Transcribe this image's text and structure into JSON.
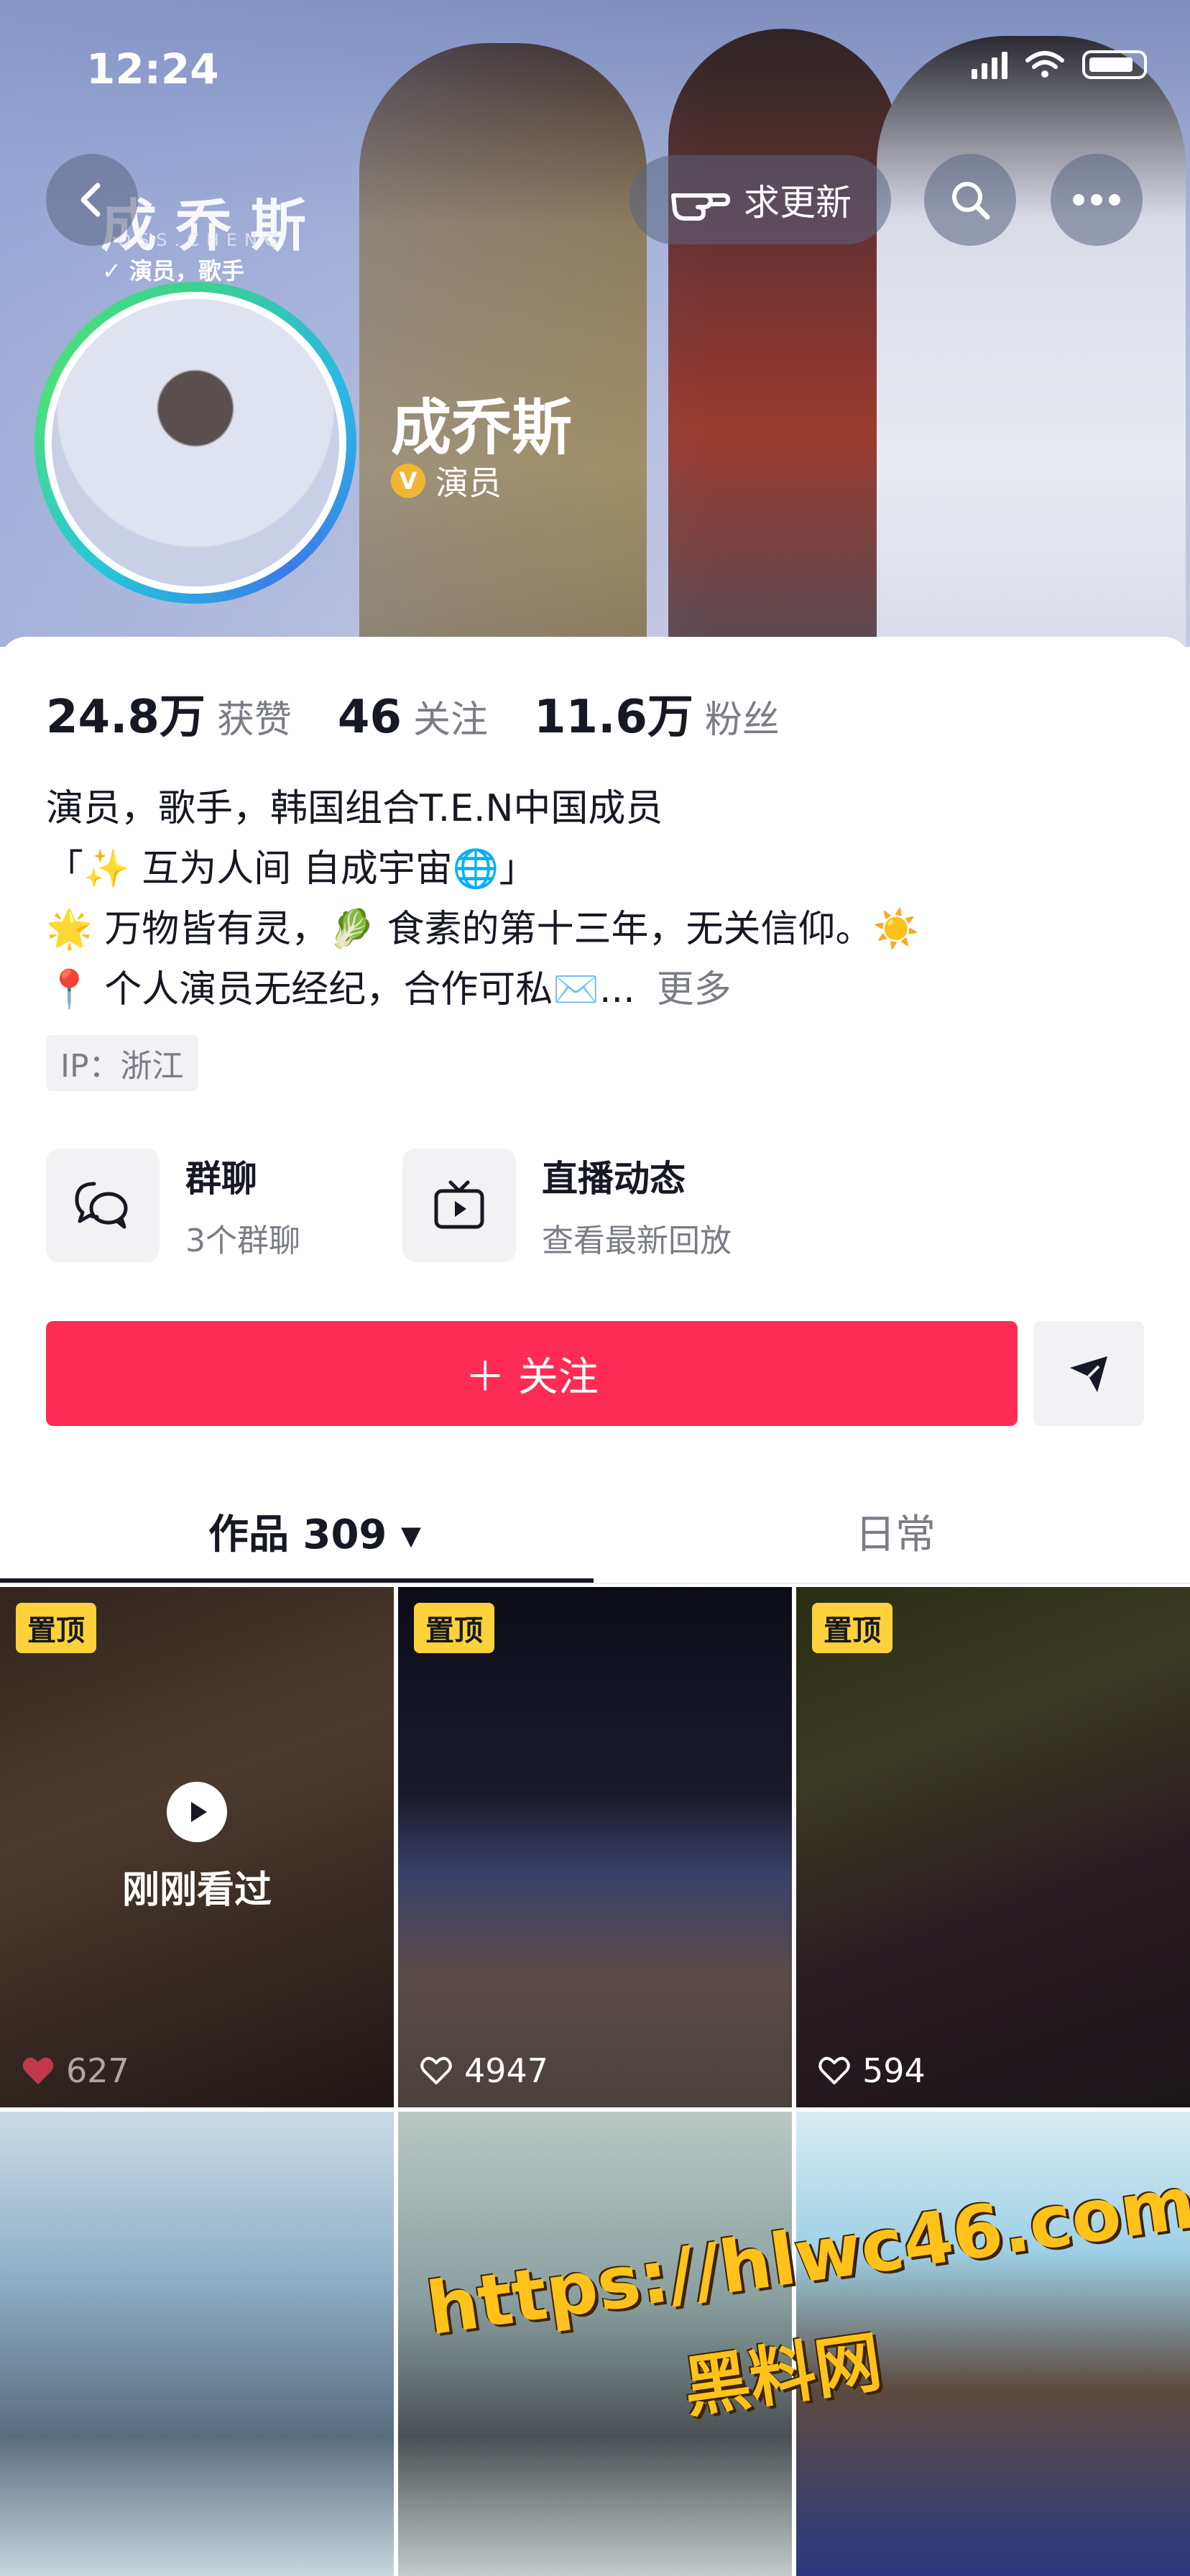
{
  "status_bar": {
    "time": "12:24"
  },
  "header": {
    "update_label": "求更新",
    "banner_brand": "成乔斯",
    "banner_brand_sub": "JOSS.CHENG",
    "banner_tag": "演员，歌手",
    "name": "成乔斯",
    "role": "演员",
    "verified_badge": "V"
  },
  "stats": [
    {
      "value": "24.8万",
      "label": "获赞"
    },
    {
      "value": "46",
      "label": "关注"
    },
    {
      "value": "11.6万",
      "label": "粉丝"
    }
  ],
  "bio": {
    "line1": "演员，歌手，韩国组合T.E.N中国成员",
    "line2": "「✨ 互为人间 自成宇宙🌐」",
    "line3": "🌟 万物皆有灵，🥬 食素的第十三年，无关信仰。☀️",
    "line4": "📍 个人演员无经纪，合作可私✉️...",
    "more": "更多"
  },
  "ip_location": "IP：浙江",
  "features": [
    {
      "title": "群聊",
      "subtitle": "3个群聊",
      "icon": "chat-bubbles-icon"
    },
    {
      "title": "直播动态",
      "subtitle": "查看最新回放",
      "icon": "tv-icon"
    }
  ],
  "follow_button": "＋ 关注",
  "tabs": [
    {
      "label": "作品 309 ▾",
      "active": true
    },
    {
      "label": "日常",
      "active": false
    }
  ],
  "videos": [
    {
      "pinned": "置顶",
      "likes": "627",
      "overlay": "刚刚看过"
    },
    {
      "pinned": "置顶",
      "likes": "4947"
    },
    {
      "pinned": "置顶",
      "likes": "594"
    },
    {
      "likes": ""
    },
    {
      "likes": ""
    },
    {
      "likes": ""
    }
  ],
  "watermark": {
    "url": "https://hlwc46.com",
    "name": "黑料网"
  },
  "colors": {
    "follow": "#fe2c55",
    "pin": "#fdd13a",
    "text": "#161823",
    "secondary": "#7a7c86"
  }
}
